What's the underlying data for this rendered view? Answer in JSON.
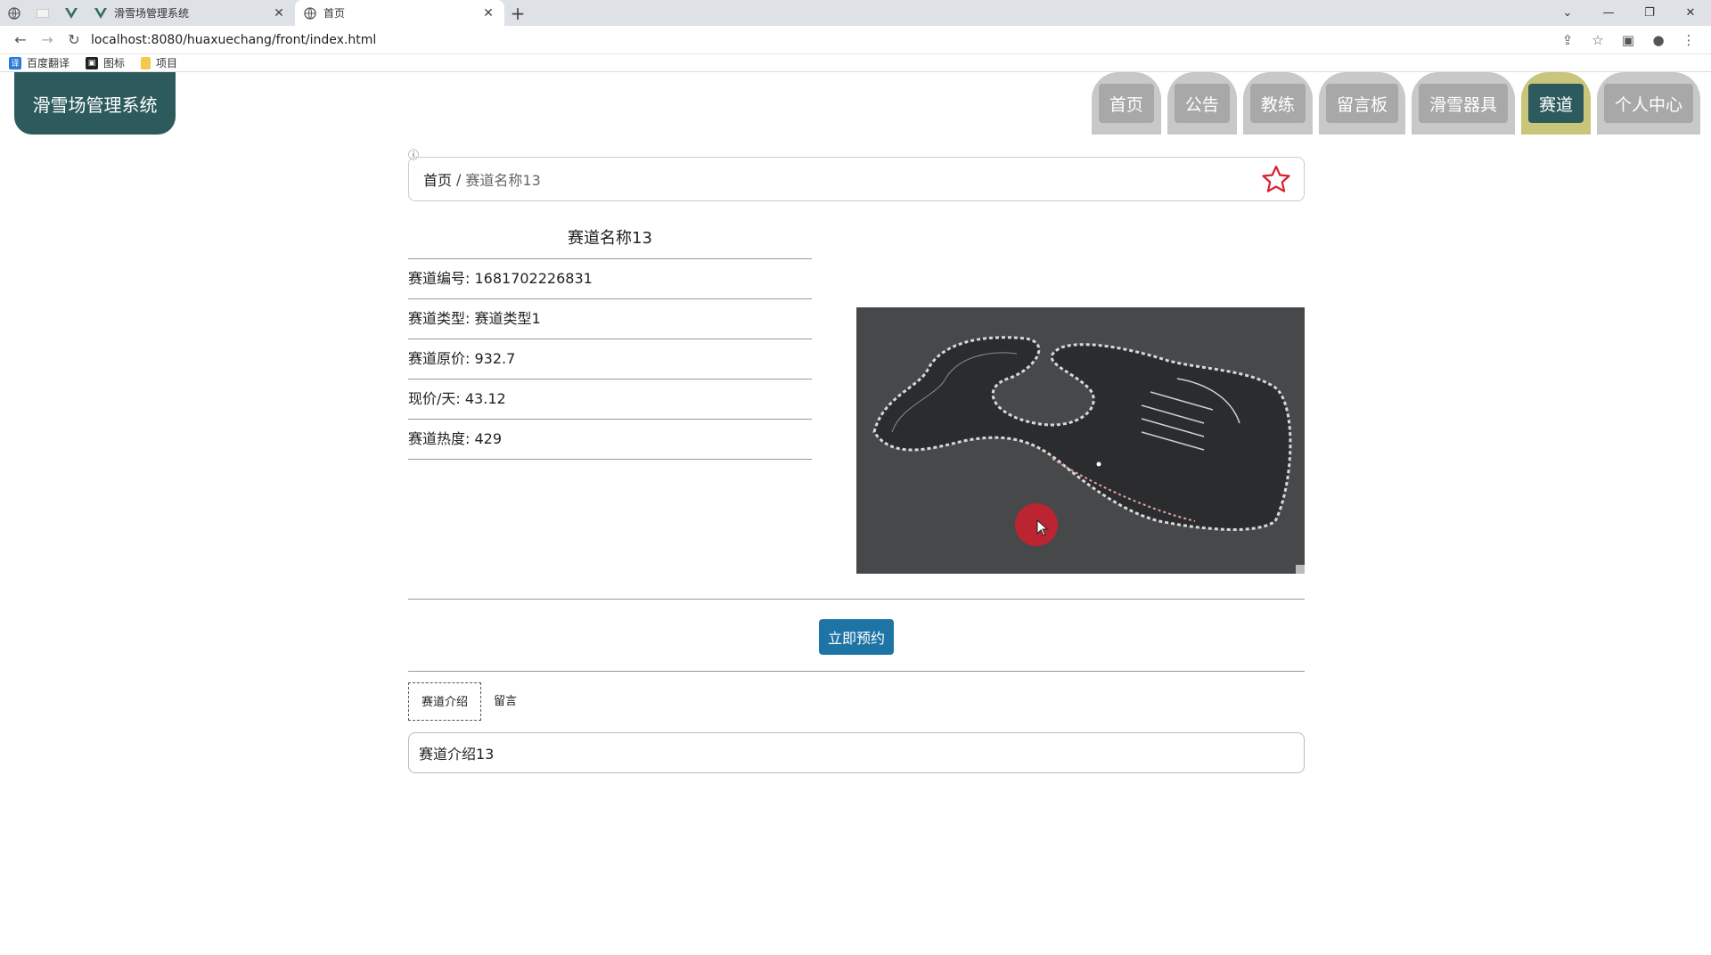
{
  "browser": {
    "tabs": [
      {
        "title": "滑雪场管理系统",
        "close": "✕"
      },
      {
        "title": "首页",
        "close": "✕"
      }
    ],
    "new_tab": "+",
    "url": "localhost:8080/huaxuechang/front/index.html",
    "bookmarks": [
      {
        "label": "百度翻译"
      },
      {
        "label": "图标"
      },
      {
        "label": "项目"
      }
    ]
  },
  "site": {
    "logo": "滑雪场管理系统",
    "nav": [
      "首页",
      "公告",
      "教练",
      "留言板",
      "滑雪器具",
      "赛道",
      "个人中心"
    ],
    "active_nav": "赛道"
  },
  "breadcrumb": {
    "home": "首页",
    "separator": "/",
    "current": "赛道名称13"
  },
  "detail": {
    "title": "赛道名称13",
    "rows": [
      "赛道编号: 1681702226831",
      "赛道类型: 赛道类型1",
      "赛道原价: 932.7",
      "现价/天: 43.12",
      "赛道热度: 429"
    ]
  },
  "book_button": "立即预约",
  "tabs": [
    {
      "label": "赛道介绍",
      "active": true
    },
    {
      "label": "留言",
      "active": false
    }
  ],
  "tab_content": "赛道介绍13",
  "colors": {
    "brand": "#2d5a5c",
    "button": "#1f74a6",
    "star": "#d9202a"
  }
}
